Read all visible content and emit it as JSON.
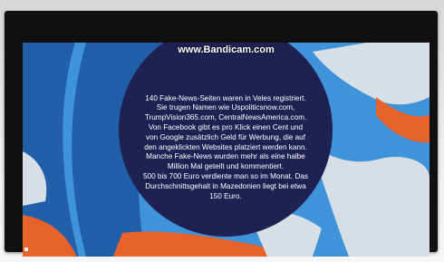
{
  "screen": {
    "watermark": "www.Bandicam.com",
    "caption": "140 Fake-News-Seiten waren in Veles registriert. Sie trugen Namen wie Uspoliticsnow.com, TrumpVision365.com, CentralNewsAmerica.com.\nVon Facebook gibt es pro Klick einen Cent und von Google zusätzlich Geld für Werbung, die auf den angeklickten Websites platziert werden kann. Manche Fake-News wurden mehr als eine halbe Million Mal geteilt und kommentiert.\n500 bis 700 Euro verdiente man so im Monat. Das Durchschnittsgehalt in Mazedonien liegt bei etwa 150 Euro."
  },
  "colors": {
    "sea": "#3f93d8",
    "land_light": "#d8dee6",
    "land_orange": "#e8622b",
    "circle": "#1e2152"
  }
}
